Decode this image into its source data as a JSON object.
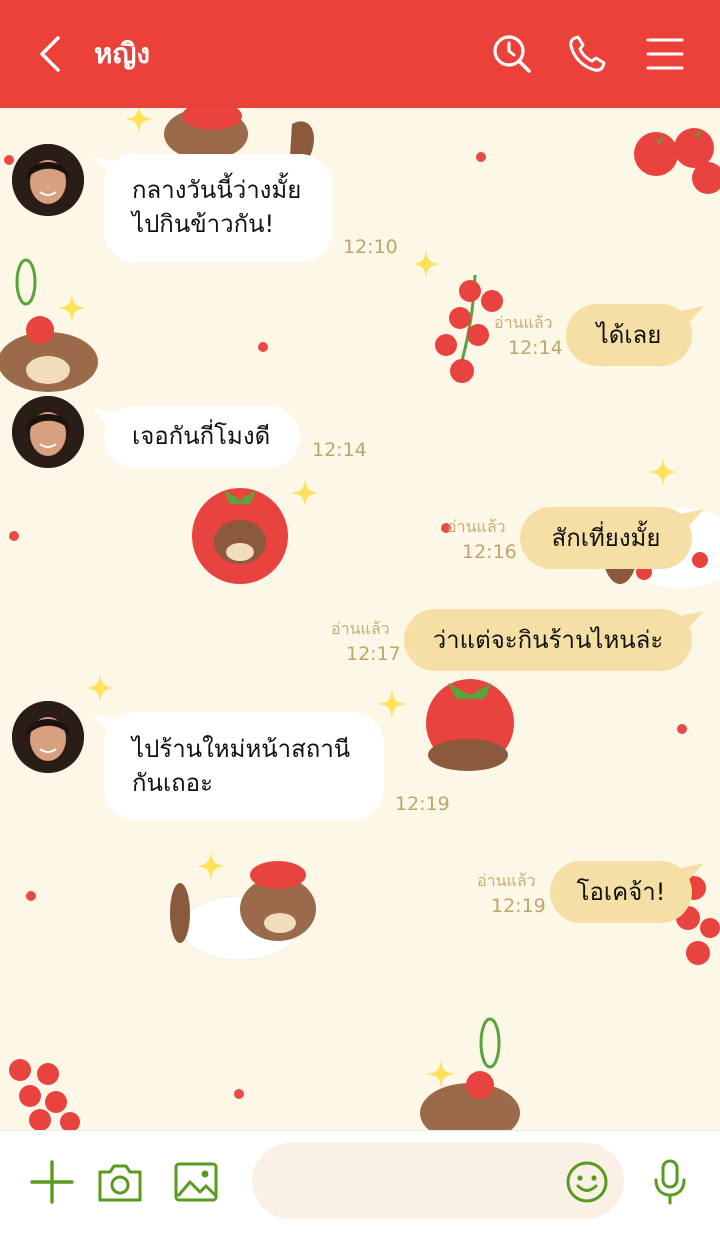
{
  "header": {
    "title": "หญิง"
  },
  "colors": {
    "header": "#ec4139",
    "incoming_bubble": "#ffffff",
    "outgoing_bubble": "#f5dfa5",
    "accent_icons": "#5a9a1e",
    "background": "#fdf7e7"
  },
  "messages": [
    {
      "direction": "in",
      "text": "กลางวันนี้ว่างมั้ย\nไปกินข้าวกัน!",
      "time": "12:10"
    },
    {
      "direction": "out",
      "text": "ได้เลย",
      "read": "อ่านแล้ว",
      "time": "12:14"
    },
    {
      "direction": "in",
      "text": "เจอกันกี่โมงดี",
      "time": "12:14"
    },
    {
      "direction": "out",
      "text": "สักเที่ยงมั้ย",
      "read": "อ่านแล้ว",
      "time": "12:16"
    },
    {
      "direction": "out",
      "text": "ว่าแต่จะกินร้านไหนล่ะ",
      "read": "อ่านแล้ว",
      "time": "12:17"
    },
    {
      "direction": "in",
      "text": "ไปร้านใหม่หน้าสถานี\nกันเถอะ",
      "time": "12:19"
    },
    {
      "direction": "out",
      "text": "โอเคจ้า!",
      "read": "อ่านแล้ว",
      "time": "12:19"
    }
  ],
  "footer": {
    "input_value": ""
  },
  "icons": [
    "back-arrow-icon",
    "search-history-icon",
    "phone-icon",
    "menu-icon",
    "plus-icon",
    "camera-icon",
    "image-icon",
    "emoji-icon",
    "microphone-icon",
    "avatar",
    "tomato-icon",
    "sparkle-icon",
    "puppy-sticker"
  ]
}
